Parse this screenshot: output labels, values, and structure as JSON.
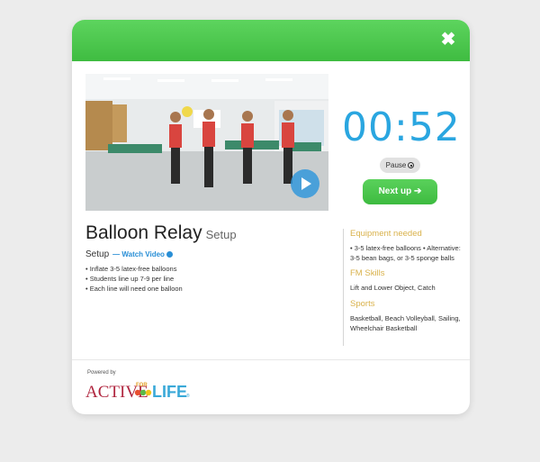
{
  "modal": {
    "close_label": "✖",
    "header_color": "#47c24a"
  },
  "video": {
    "play_icon": "play-icon"
  },
  "timer": {
    "display": "00:52",
    "pause_label": "Pause",
    "next_label": "Next up",
    "next_arrow": "➔"
  },
  "activity": {
    "title": "Balloon Relay",
    "title_sub": "Setup",
    "setup_label": "Setup",
    "watch_video_label": "— Watch Video",
    "setup_items": [
      "Inflate 3-5 latex-free balloons",
      "Students line up 7-9 per line",
      "Each line will need one balloon"
    ]
  },
  "sidebar": {
    "equipment_heading": "Equipment needed",
    "equipment_text": "• 3-5 latex-free balloons • Alternative: 3-5 bean bags, or 3-5 sponge balls",
    "fm_heading": "FM Skills",
    "fm_text": "Lift and Lower Object, Catch",
    "sports_heading": "Sports",
    "sports_text": "Basketball, Beach Volleyball, Sailing, Wheelchair Basketball"
  },
  "footer": {
    "powered_by": "Powered by",
    "logo_text_active": "ACTIVE",
    "logo_text_for": "FOR",
    "logo_text_life": "LIFE",
    "logo_mark": "®"
  }
}
